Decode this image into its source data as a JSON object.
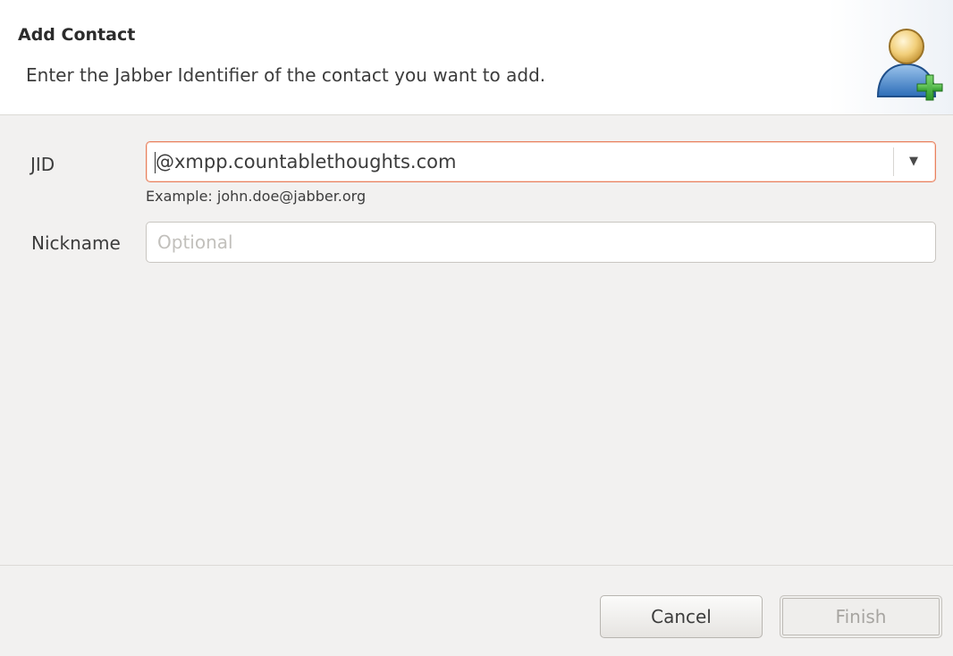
{
  "header": {
    "title": "Add Contact",
    "description": "Enter the Jabber Identifier of the contact you want to add.",
    "icon": "add-contact-icon"
  },
  "form": {
    "jid": {
      "label": "JID",
      "value": "@xmpp.countablethoughts.com",
      "hint": "Example: john.doe@jabber.org"
    },
    "nickname": {
      "label": "Nickname",
      "value": "",
      "placeholder": "Optional"
    }
  },
  "buttons": {
    "cancel": "Cancel",
    "finish": "Finish"
  },
  "colors": {
    "focus_border": "#e8805f",
    "background": "#f2f1f0",
    "banner": "#ffffff",
    "disabled_text": "#a7a5a1"
  }
}
